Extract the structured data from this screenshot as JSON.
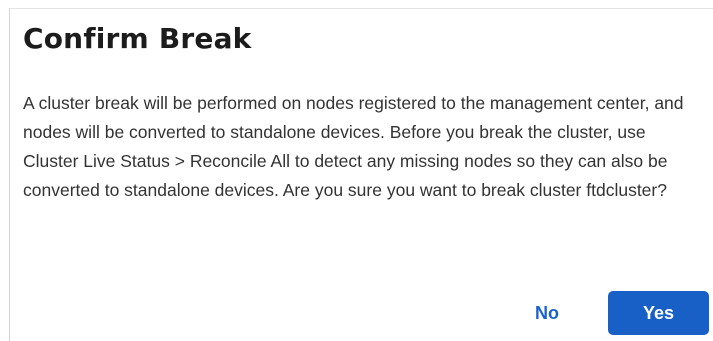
{
  "dialog": {
    "title": "Confirm Break",
    "message": "A cluster break will be performed on nodes registered to the management center, and nodes will be converted to standalone devices. Before you break the cluster, use Cluster Live Status > Reconcile All to detect any missing nodes so they can also be converted to standalone devices. Are you sure you want to break cluster ftdcluster?",
    "no_label": "No",
    "yes_label": "Yes"
  },
  "colors": {
    "primary": "#1860c6",
    "link": "#1b62c8",
    "title_text": "#1c1c1c",
    "body_text": "#333333"
  }
}
